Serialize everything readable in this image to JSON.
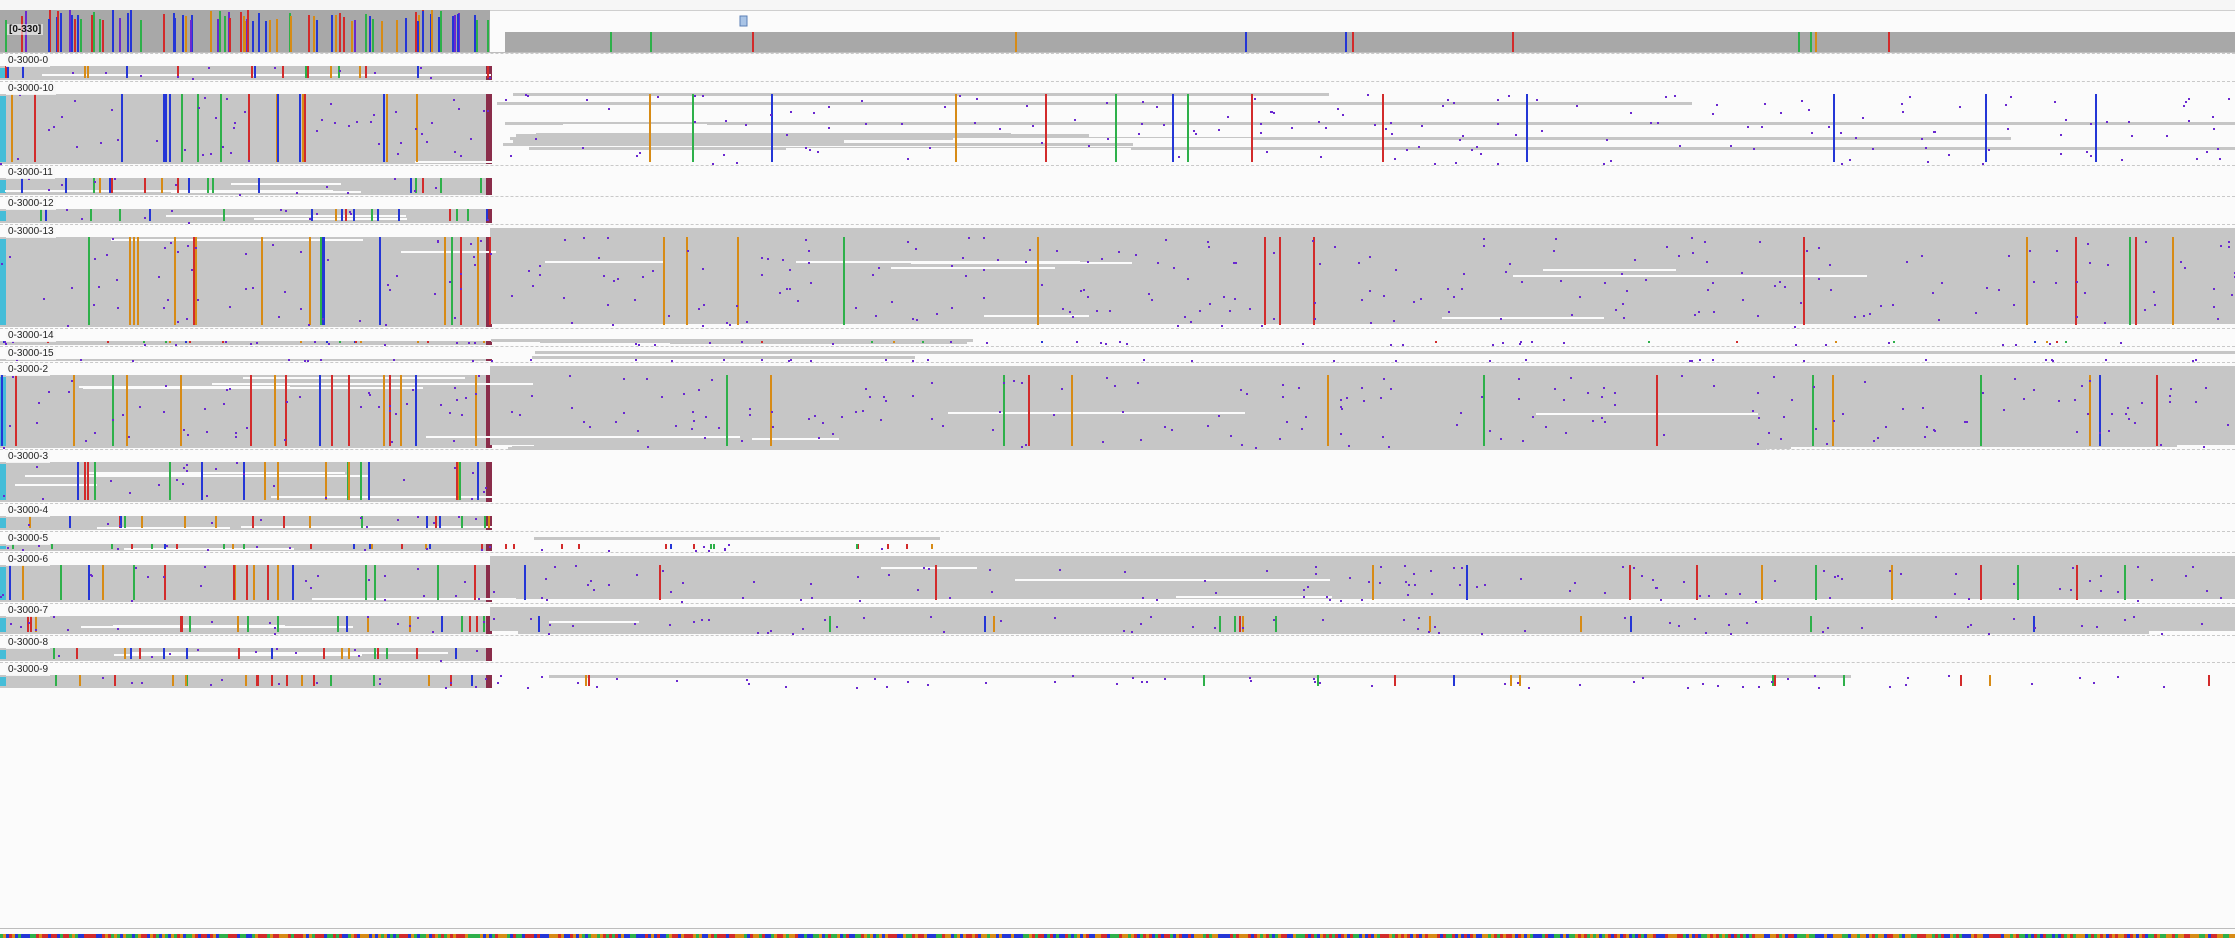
{
  "coverage_track": {
    "label": "[0-330]"
  },
  "tracks": [
    {
      "label": "0-3000-0"
    },
    {
      "label": "0-3000-10"
    },
    {
      "label": "0-3000-11"
    },
    {
      "label": "0-3000-12"
    },
    {
      "label": "0-3000-13"
    },
    {
      "label": "0-3000-14"
    },
    {
      "label": "0-3000-15"
    },
    {
      "label": "0-3000-2"
    },
    {
      "label": "0-3000-3"
    },
    {
      "label": "0-3000-4"
    },
    {
      "label": "0-3000-5"
    },
    {
      "label": "0-3000-6"
    },
    {
      "label": "0-3000-7"
    },
    {
      "label": "0-3000-8"
    },
    {
      "label": "0-3000-9"
    }
  ],
  "colors": {
    "read": "#c6c6c6",
    "mismatch_purple": "#6a28d0",
    "base_A_green": "#2eb04a",
    "base_C_blue": "#2436d6",
    "base_G_orange": "#d78b16",
    "base_T_red": "#d22b2b",
    "coverage_gray": "#a8a8a8",
    "clip_cyan": "#45bdd8"
  }
}
